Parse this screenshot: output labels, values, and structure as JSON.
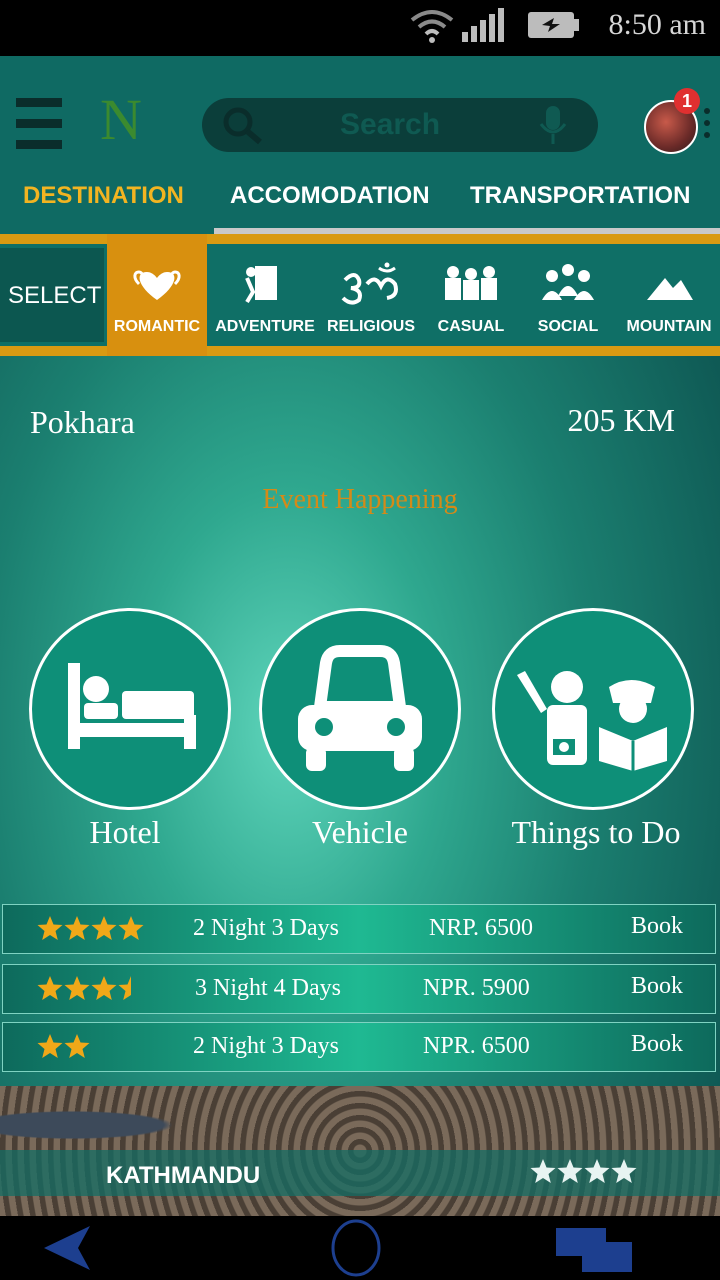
{
  "status": {
    "time": "8:50 am"
  },
  "header": {
    "logo": "N",
    "search_placeholder": "Search",
    "notification_count": "1"
  },
  "tabs": [
    {
      "label": "DESTINATION",
      "active": true
    },
    {
      "label": "ACCOMODATION",
      "active": false
    },
    {
      "label": "TRANSPORTATION",
      "active": false
    }
  ],
  "categories": {
    "select_label": "SELECT",
    "items": [
      {
        "label": "ROMANTIC",
        "icon": "hearts-icon",
        "active": true
      },
      {
        "label": "ADVENTURE",
        "icon": "climber-icon",
        "active": false
      },
      {
        "label": "RELIGIOUS",
        "icon": "om-icon",
        "active": false
      },
      {
        "label": "CASUAL",
        "icon": "people-icon",
        "active": false
      },
      {
        "label": "SOCIAL",
        "icon": "group-icon",
        "active": false
      },
      {
        "label": "MOUNTAIN",
        "icon": "mountain-icon",
        "active": false
      }
    ]
  },
  "destination": {
    "place": "Pokhara",
    "distance": "205 KM",
    "event": "Event Happening"
  },
  "services": [
    {
      "label": "Hotel",
      "icon": "bed-icon"
    },
    {
      "label": "Vehicle",
      "icon": "car-icon"
    },
    {
      "label": "Things to Do",
      "icon": "tourists-icon"
    }
  ],
  "packages": [
    {
      "rating": 4,
      "duration": "2 Night 3 Days",
      "price": "NRP. 6500",
      "book": "Book"
    },
    {
      "rating": 3.5,
      "duration": "3 Night 4 Days",
      "price": "NPR. 5900",
      "book": "Book"
    },
    {
      "rating": 2,
      "duration": "2 Night 3 Days",
      "price": "NPR. 6500",
      "book": "Book"
    }
  ],
  "featured": {
    "city": "KATHMANDU",
    "rating": 4
  },
  "colors": {
    "accent": "#f2b421",
    "gold": "#d99a12",
    "teal": "#0f6a63"
  }
}
